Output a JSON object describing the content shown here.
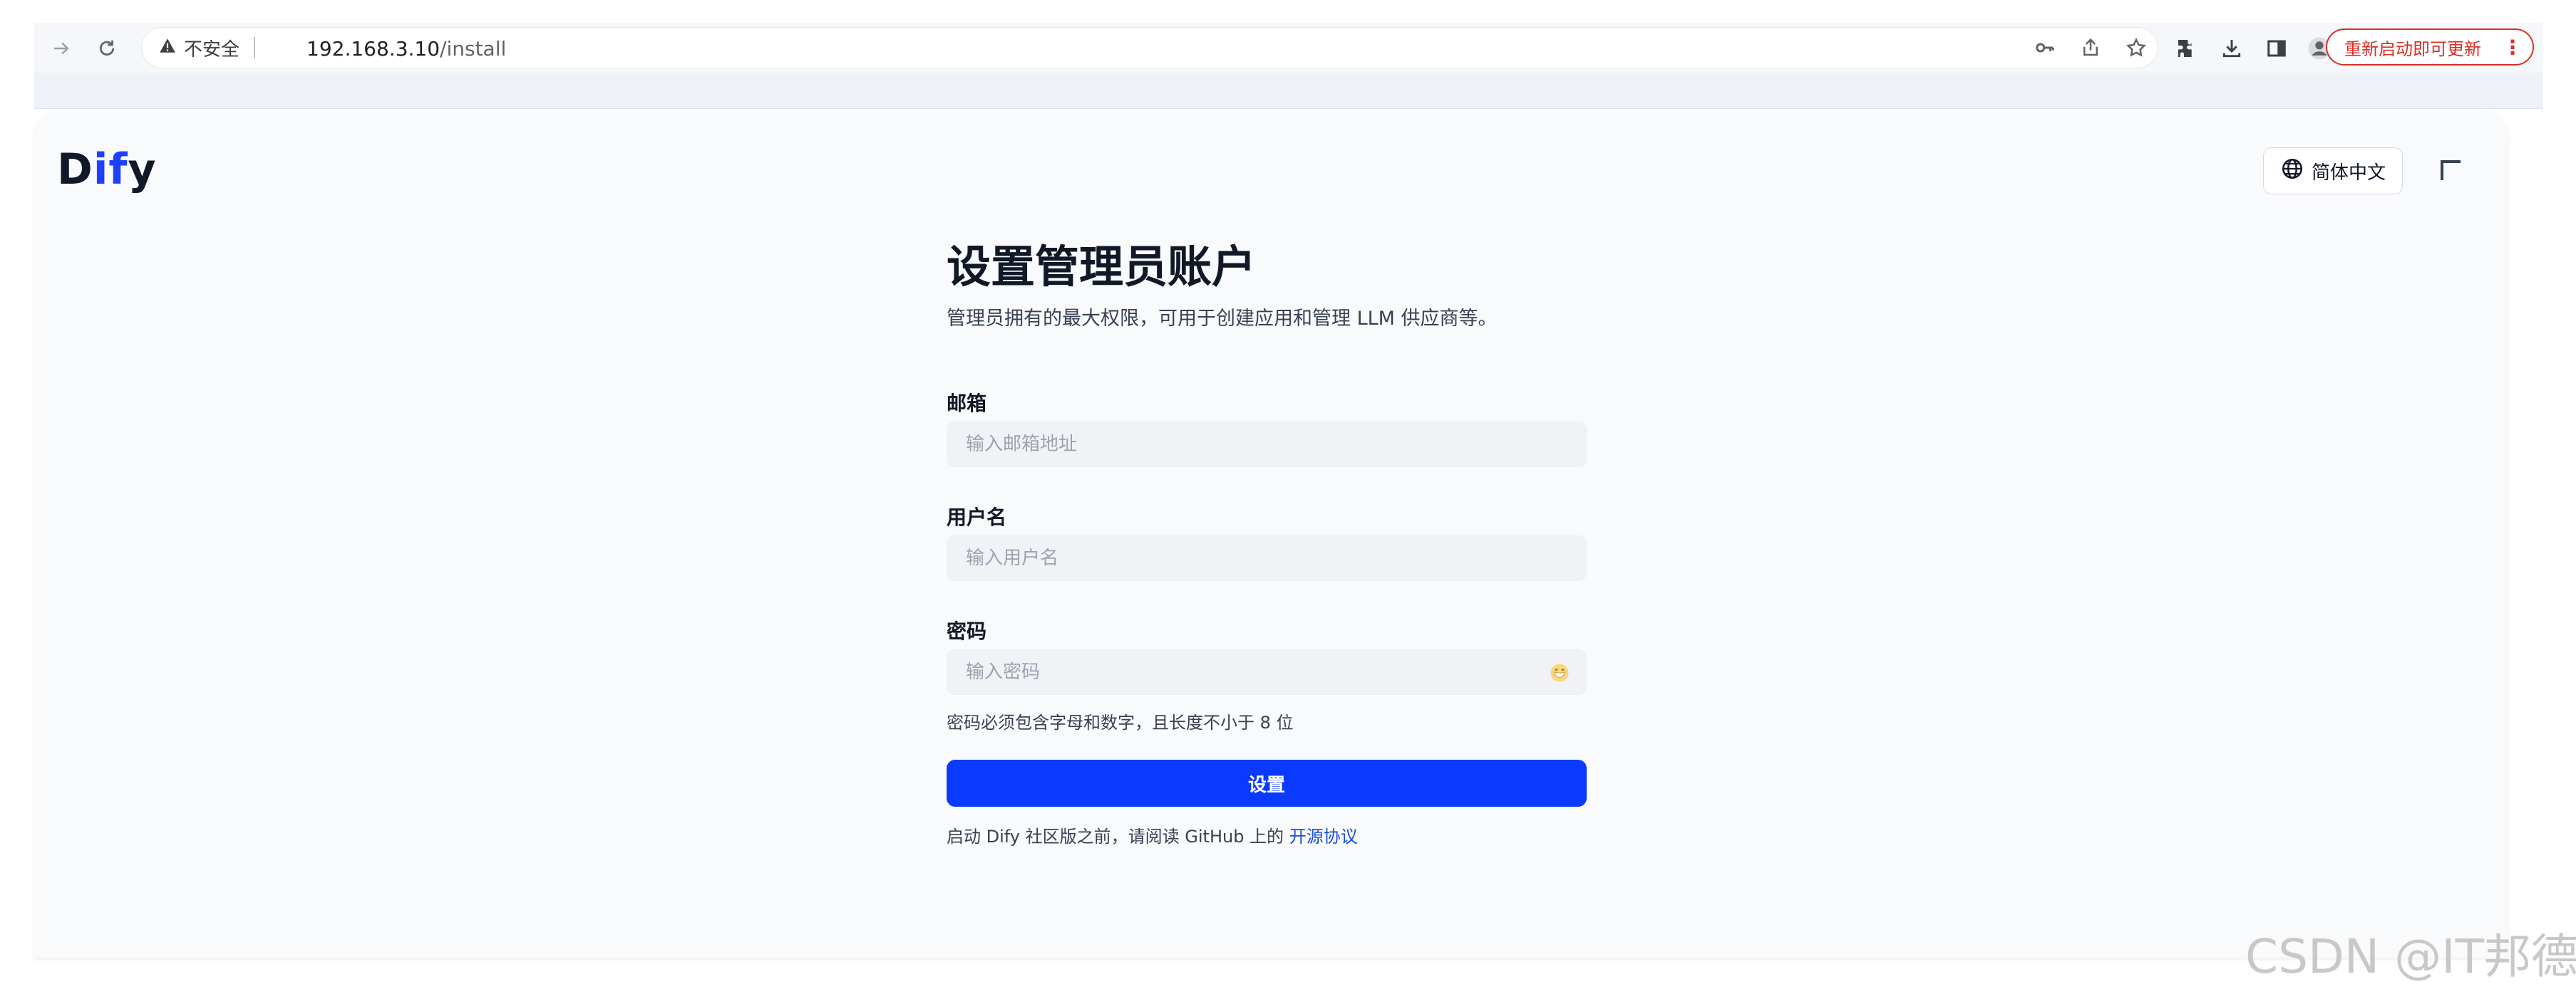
{
  "browser": {
    "security_label": "不安全",
    "url_host": "192.168.3.10",
    "url_path": "/install",
    "update_button": "重新启动即可更新"
  },
  "app": {
    "logo": {
      "prefix": "D",
      "highlight": "if",
      "suffix": "y"
    },
    "language_button": "简体中文",
    "title": "设置管理员账户",
    "subtitle": "管理员拥有的最大权限，可用于创建应用和管理 LLM 供应商等。",
    "email": {
      "label": "邮箱",
      "placeholder": "输入邮箱地址",
      "value": ""
    },
    "username": {
      "label": "用户名",
      "placeholder": "输入用户名",
      "value": ""
    },
    "password": {
      "label": "密码",
      "placeholder": "输入密码",
      "value": "",
      "hint": "密码必须包含字母和数字，且长度不小于 8 位"
    },
    "submit_button": "设置",
    "footer": {
      "text": "启动 Dify 社区版之前，请阅读 GitHub 上的 ",
      "link": "开源协议"
    }
  },
  "watermark": "CSDN @IT邦德",
  "colors": {
    "primary": "#0b3aff",
    "logo_blue": "#1e40ff",
    "warning_red": "#d93025"
  }
}
